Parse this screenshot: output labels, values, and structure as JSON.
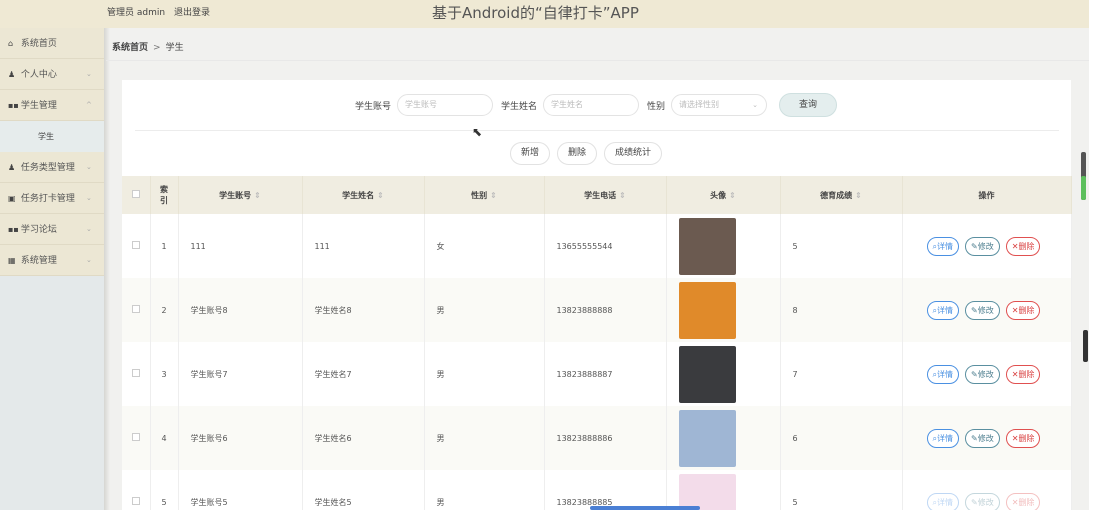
{
  "header": {
    "admin_label": "管理员 admin",
    "logout": "退出登录",
    "title": "基于Android的“自律打卡”APP"
  },
  "sidebar": {
    "items": [
      {
        "icon": "home-icon",
        "glyph": "⌂",
        "label": "系统首页",
        "chevron": ""
      },
      {
        "icon": "user-icon",
        "glyph": "♟",
        "label": "个人中心",
        "chevron": "⌄"
      },
      {
        "icon": "grid-icon",
        "glyph": "▪▪",
        "label": "学生管理",
        "chevron": "^"
      },
      {
        "icon": "user-icon",
        "glyph": "♟",
        "label": "任务类型管理",
        "chevron": "⌄"
      },
      {
        "icon": "clipboard-icon",
        "glyph": "▣",
        "label": "任务打卡管理",
        "chevron": "⌄"
      },
      {
        "icon": "grid-icon",
        "glyph": "▪▪",
        "label": "学习论坛",
        "chevron": "⌄"
      },
      {
        "icon": "grid-icon",
        "glyph": "▦",
        "label": "系统管理",
        "chevron": "⌄"
      }
    ],
    "sub_item": "学生"
  },
  "breadcrumb": {
    "home": "系统首页",
    "sep": ">",
    "current": "学生"
  },
  "search": {
    "account_label": "学生账号",
    "account_placeholder": "学生账号",
    "name_label": "学生姓名",
    "name_placeholder": "学生姓名",
    "gender_label": "性别",
    "gender_placeholder": "请选择性别",
    "query_button": "查询"
  },
  "actions": {
    "add": "新增",
    "delete": "删除",
    "stats": "成绩统计"
  },
  "table": {
    "headers": {
      "index": "索\n引",
      "account": "学生账号",
      "name": "学生姓名",
      "gender": "性别",
      "phone": "学生电话",
      "avatar": "头像",
      "score": "德育成绩",
      "ops": "操作"
    },
    "sort_glyph": "⇕",
    "op_labels": {
      "detail": "详情",
      "edit": "修改",
      "delete": "删除"
    },
    "rows": [
      {
        "index": "1",
        "account": "111",
        "name": "111",
        "gender": "女",
        "phone": "13655555544",
        "score": "5",
        "avatar_color": "#6b5a50"
      },
      {
        "index": "2",
        "account": "学生账号8",
        "name": "学生姓名8",
        "gender": "男",
        "phone": "13823888888",
        "score": "8",
        "avatar_color": "#e08a2a"
      },
      {
        "index": "3",
        "account": "学生账号7",
        "name": "学生姓名7",
        "gender": "男",
        "phone": "13823888887",
        "score": "7",
        "avatar_color": "#3a3b3e"
      },
      {
        "index": "4",
        "account": "学生账号6",
        "name": "学生姓名6",
        "gender": "男",
        "phone": "13823888886",
        "score": "6",
        "avatar_color": "#9fb6d4"
      },
      {
        "index": "5",
        "account": "学生账号5",
        "name": "学生姓名5",
        "gender": "男",
        "phone": "13823888885",
        "score": "5",
        "avatar_color": "#f3dcea"
      }
    ]
  }
}
